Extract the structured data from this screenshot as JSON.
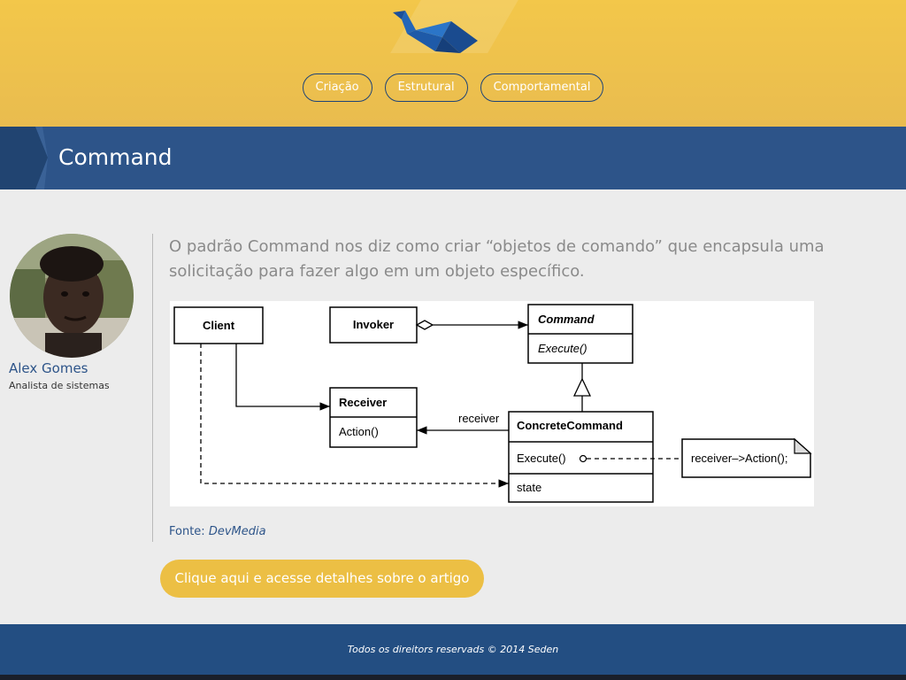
{
  "header": {
    "logo_icon": "origami-bird-icon",
    "nav": [
      {
        "label": "Criação"
      },
      {
        "label": "Estrutural"
      },
      {
        "label": "Comportamental"
      }
    ]
  },
  "page": {
    "title": "Command"
  },
  "author": {
    "name": "Alex Gomes",
    "role": "Analista de sistemas"
  },
  "article": {
    "intro": "O padrão Command nos diz como criar “objetos de comando” que encapsula uma solicitação para fazer algo em um objeto específico.",
    "source_label": "Fonte:",
    "source_link": "DevMedia",
    "cta": "Clique aqui e acesse detalhes sobre o artigo"
  },
  "diagram": {
    "client": "Client",
    "invoker": "Invoker",
    "command": "Command",
    "command_execute": "Execute()",
    "receiver": "Receiver",
    "receiver_action": "Action()",
    "receiver_label": "receiver",
    "concrete": "ConcreteCommand",
    "concrete_execute": "Execute()",
    "concrete_state": "state",
    "note": "receiver–>Action();"
  },
  "footer": {
    "text": "Todos os direitors reservads © 2014 Seden"
  },
  "colors": {
    "header": "#f0c44b",
    "band": "#2d5489",
    "footer": "#234e82",
    "cta": "#ecbf44"
  }
}
